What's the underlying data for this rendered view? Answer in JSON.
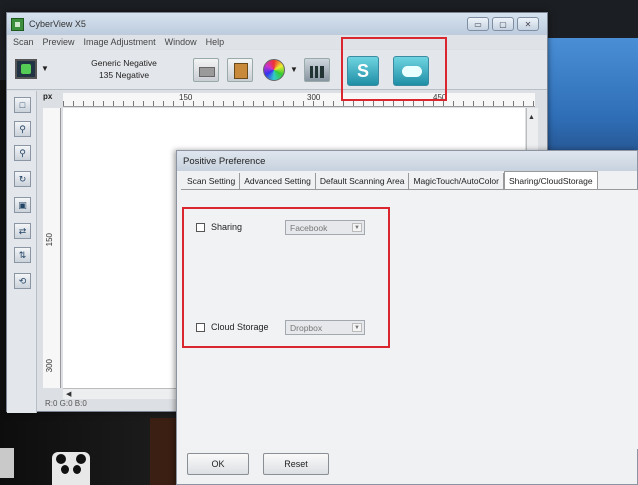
{
  "app": {
    "title": "CyberView X5",
    "window_controls": [
      "▭",
      "▢",
      "✕"
    ],
    "menu": [
      "Scan",
      "Preview",
      "Image Adjustment",
      "Window",
      "Help"
    ]
  },
  "toolbar": {
    "film_type_line1": "Generic Negative",
    "film_type_line2": "135 Negative",
    "share_icon": "share-swoosh-icon",
    "cloud_icon": "cloud-icon",
    "highlight_color": "#d9262f"
  },
  "preview": {
    "unit": "px",
    "ruler_top": [
      "150",
      "300",
      "450"
    ],
    "ruler_left": [
      "150",
      "300"
    ],
    "status": "R:0 G:0 B:0"
  },
  "dialog": {
    "title": "Positive Preference",
    "tabs": [
      "Scan Setting",
      "Advanced Setting",
      "Default Scanning Area",
      "MagicTouch/AutoColor",
      "Sharing/CloudStorage"
    ],
    "active_tab": "Sharing/CloudStorage",
    "sharing_label": "Sharing",
    "sharing_value": "Facebook",
    "cloud_label": "Cloud Storage",
    "cloud_value": "Dropbox",
    "ok_label": "OK",
    "reset_label": "Reset"
  }
}
